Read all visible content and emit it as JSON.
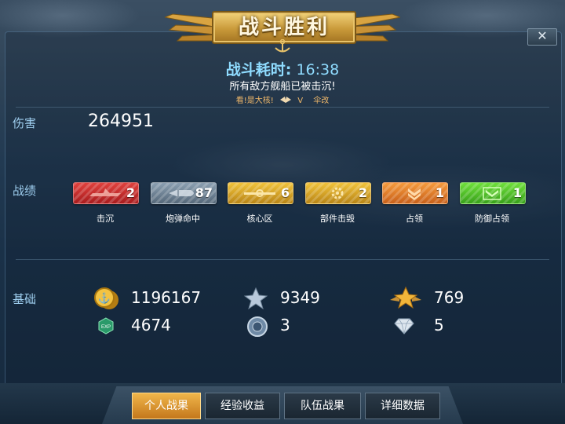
{
  "header": {
    "title": "战斗胜利",
    "time_label": "战斗耗时:",
    "time_value": "16:38",
    "message": "所有敌方舰船已被击沉!",
    "sub_items": [
      "看!是大核!",
      "V",
      "伞改"
    ],
    "close_label": "✕"
  },
  "damage": {
    "label": "伤害",
    "value": "264951"
  },
  "record": {
    "label": "战绩",
    "badges": [
      {
        "label": "击沉",
        "count": "2",
        "icon": "aircraft-sink-icon",
        "color": "#c8282a"
      },
      {
        "label": "炮弹命中",
        "count": "87",
        "icon": "shell-hit-icon",
        "color": "#6d8294"
      },
      {
        "label": "核心区",
        "count": "6",
        "icon": "core-zone-icon",
        "color": "#d6a21c"
      },
      {
        "label": "部件击毁",
        "count": "2",
        "icon": "part-destroy-icon",
        "color": "#d6a21c"
      },
      {
        "label": "占领",
        "count": "1",
        "icon": "capture-chevron-icon",
        "color": "#e06d1c"
      },
      {
        "label": "防御占领",
        "count": "1",
        "icon": "defend-chevron-icon",
        "color": "#46b82a"
      }
    ]
  },
  "base": {
    "label": "基础",
    "resources": [
      {
        "value": "1196167",
        "icon": "gold-coin-icon"
      },
      {
        "value": "9349",
        "icon": "silver-star-icon"
      },
      {
        "value": "769",
        "icon": "gold-star-wings-icon"
      },
      {
        "value": "4674",
        "icon": "exp-hexagon-icon"
      },
      {
        "value": "3",
        "icon": "globe-medal-icon"
      },
      {
        "value": "5",
        "icon": "diamond-icon"
      }
    ]
  },
  "tabs": [
    {
      "label": "个人战果",
      "active": true
    },
    {
      "label": "经验收益",
      "active": false
    },
    {
      "label": "队伍战果",
      "active": false
    },
    {
      "label": "详细数据",
      "active": false
    }
  ]
}
